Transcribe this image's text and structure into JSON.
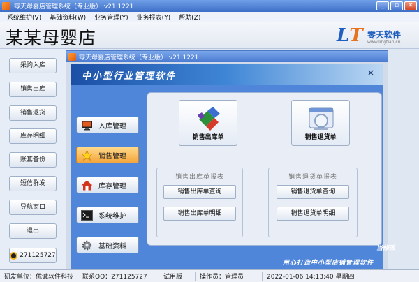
{
  "app": {
    "title": "零天母婴店管理系统（专业版）  v21.1221"
  },
  "menu": [
    "系统维护(V)",
    "基础资料(W)",
    "业务管理(Y)",
    "业务报表(Y)",
    "帮助(Z)"
  ],
  "header": {
    "store_name": "某某母婴店",
    "logo_brand": "零天软件",
    "logo_url": "www.lingtian.cn"
  },
  "sidebar": {
    "items": [
      "采购入库",
      "销售出库",
      "销售退货",
      "库存明细",
      "账套备份",
      "短信群发",
      "导航窗口",
      "退出"
    ],
    "qq": "271125727"
  },
  "inner_window": {
    "title": "零天母婴店管理系统（专业版）  v21.1221",
    "slogan": "中小型行业管理软件",
    "footer": "用心打造中小型店铺管理软件",
    "corner_text": "当修改",
    "nav": [
      "入库管理",
      "销售管理",
      "库存管理",
      "系统维护",
      "基础资料"
    ],
    "big_buttons": [
      "销售出库单",
      "销售退货单"
    ],
    "groups": [
      {
        "title": "销售出库单报表",
        "buttons": [
          "销售出库单查询",
          "销售出库单明细"
        ]
      },
      {
        "title": "销售退货单报表",
        "buttons": [
          "销售退货单查询",
          "销售退货单明细"
        ]
      }
    ]
  },
  "status": {
    "dev": "研发单位：优诚软件科技",
    "contact": "联系QQ：271125727",
    "edition": "试用版",
    "operator": "操作员：管理员",
    "datetime": "2022-01-06 14:13:40 星期四"
  },
  "colors": {
    "accent_blue": "#4f86d9",
    "active_nav": "#f3a53b",
    "title_bar": "#3e6fc8"
  },
  "icons": [
    "monitor-icon",
    "star-icon",
    "house-icon",
    "terminal-icon",
    "gear-icon",
    "puzzle-icon",
    "window-return-icon",
    "qq-icon"
  ]
}
